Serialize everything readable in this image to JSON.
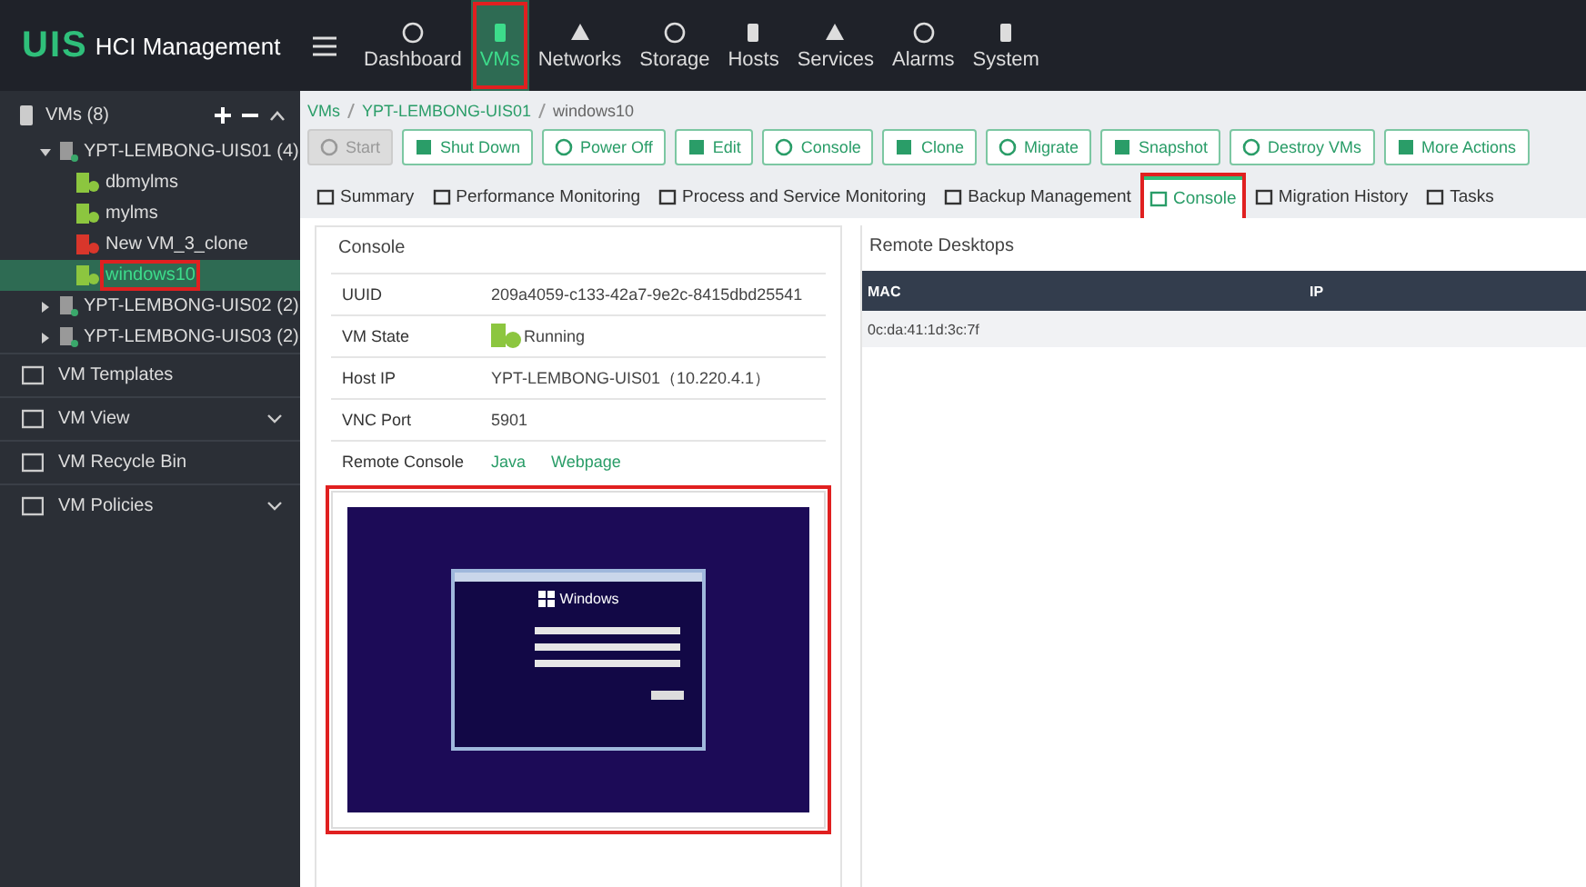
{
  "app": {
    "logo": "UIS",
    "title": "HCI Management"
  },
  "nav": [
    {
      "label": "Dashboard",
      "selected": false,
      "highlighted": false
    },
    {
      "label": "VMs",
      "selected": true,
      "highlighted": true
    },
    {
      "label": "Networks",
      "selected": false,
      "highlighted": false
    },
    {
      "label": "Storage",
      "selected": false,
      "highlighted": false
    },
    {
      "label": "Hosts",
      "selected": false,
      "highlighted": false
    },
    {
      "label": "Services",
      "selected": false,
      "highlighted": false
    },
    {
      "label": "Alarms",
      "selected": false,
      "highlighted": false
    },
    {
      "label": "System",
      "selected": false,
      "highlighted": false
    }
  ],
  "sidebar": {
    "root": {
      "label": "VMs (8)",
      "expanded": true,
      "children": [
        {
          "label": "YPT-LEMBONG-UIS01 (4)",
          "expanded": true,
          "children": [
            {
              "label": "dbmylms",
              "running": true,
              "selected": false,
              "highlighted": false
            },
            {
              "label": "mylms",
              "running": true,
              "selected": false,
              "highlighted": false
            },
            {
              "label": "New VM_3_clone",
              "running": false,
              "selected": false,
              "highlighted": false
            },
            {
              "label": "windows10",
              "running": true,
              "selected": true,
              "highlighted": true
            }
          ]
        },
        {
          "label": "YPT-LEMBONG-UIS02 (2)",
          "expanded": false
        },
        {
          "label": "YPT-LEMBONG-UIS03 (2)",
          "expanded": false
        }
      ]
    },
    "menu": [
      {
        "label": "VM Templates",
        "has_submenu": false
      },
      {
        "label": "VM View",
        "has_submenu": true
      },
      {
        "label": "VM Recycle Bin",
        "has_submenu": false
      },
      {
        "label": "VM Policies",
        "has_submenu": true
      }
    ]
  },
  "breadcrumb": [
    "VMs",
    "YPT-LEMBONG-UIS01",
    "windows10"
  ],
  "actions": [
    {
      "label": "Start",
      "disabled": true
    },
    {
      "label": "Shut Down",
      "disabled": false
    },
    {
      "label": "Power Off",
      "disabled": false
    },
    {
      "label": "Edit",
      "disabled": false
    },
    {
      "label": "Console",
      "disabled": false
    },
    {
      "label": "Clone",
      "disabled": false
    },
    {
      "label": "Migrate",
      "disabled": false
    },
    {
      "label": "Snapshot",
      "disabled": false
    },
    {
      "label": "Destroy VMs",
      "disabled": false
    },
    {
      "label": "More Actions",
      "disabled": false
    }
  ],
  "tabs": [
    {
      "label": "Summary",
      "selected": false,
      "highlighted": false
    },
    {
      "label": "Performance Monitoring",
      "selected": false,
      "highlighted": false
    },
    {
      "label": "Process and Service Monitoring",
      "selected": false,
      "highlighted": false
    },
    {
      "label": "Backup Management",
      "selected": false,
      "highlighted": false
    },
    {
      "label": "Console",
      "selected": true,
      "highlighted": true
    },
    {
      "label": "Migration History",
      "selected": false,
      "highlighted": false
    },
    {
      "label": "Tasks",
      "selected": false,
      "highlighted": false
    }
  ],
  "console": {
    "title": "Console",
    "rows": [
      {
        "kind": "text",
        "label": "UUID",
        "value": "209a4059-c133-42a7-9e2c-8415dbd25541"
      },
      {
        "kind": "state",
        "label": "VM State",
        "value": "Running"
      },
      {
        "kind": "text",
        "label": "Host IP",
        "value": "YPT-LEMBONG-UIS01（10.220.4.1）"
      },
      {
        "kind": "text",
        "label": "VNC Port",
        "value": "5901"
      },
      {
        "kind": "links",
        "label": "Remote Console",
        "links": [
          "Java",
          "Webpage"
        ]
      }
    ],
    "preview": {
      "highlighted": true,
      "caption": "Windows"
    }
  },
  "remote_desktops": {
    "title": "Remote Desktops",
    "columns": [
      "MAC",
      "IP"
    ],
    "rows": [
      [
        "0c:da:41:1d:3c:7f"
      ]
    ]
  }
}
